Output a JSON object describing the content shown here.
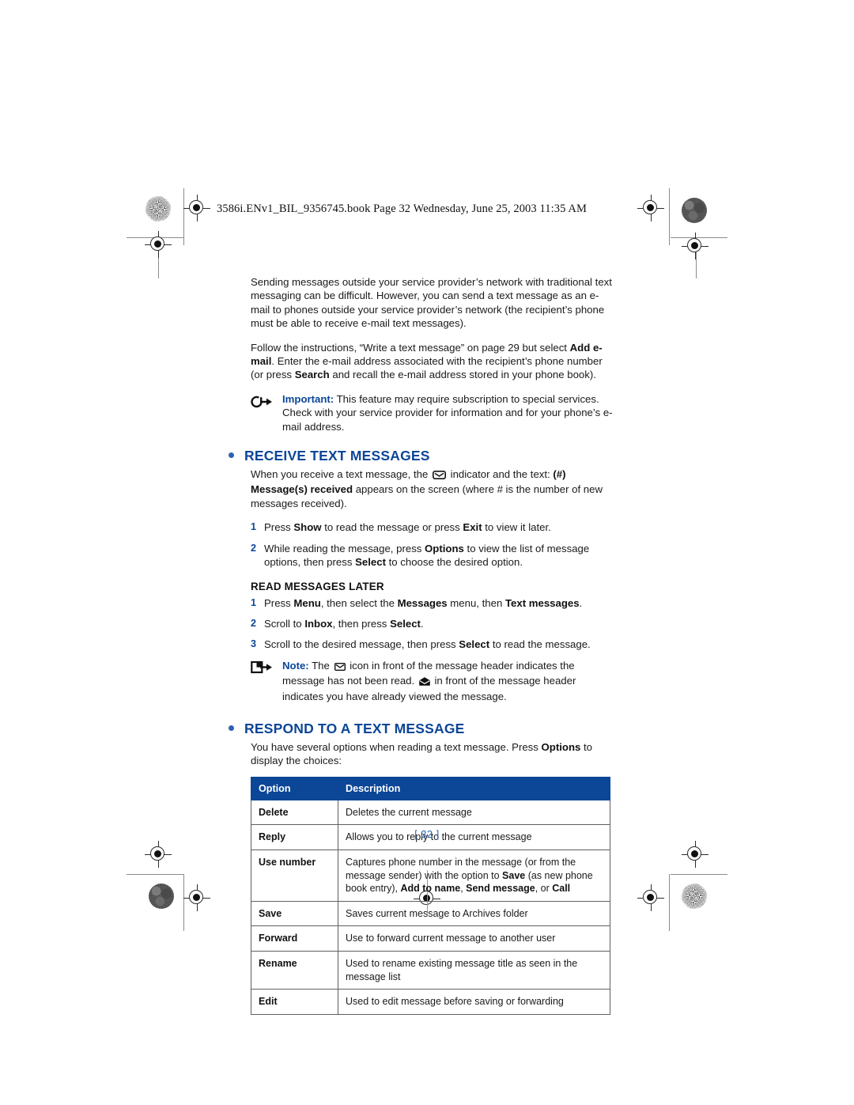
{
  "header": {
    "file_line": "3586i.ENv1_BIL_9356745.book  Page 32  Wednesday, June 25, 2003  11:35 AM"
  },
  "colors": {
    "heading_blue": "#0b4697",
    "bullet_blue": "#2b62b4",
    "table_header_bg": "#0b4697",
    "body_text": "#1a1a1a"
  },
  "intro": {
    "para1_a": "Sending messages outside your service provider’s network with traditional text messaging can be difficult. However, you can send a text message as an e-mail to phones outside your service provider’s network (the recipient’s phone must be able to receive e-mail text messages).",
    "para2_a": "Follow the instructions, “Write a text message” on page 29 but select ",
    "para2_b": "Add e-mail",
    "para2_c": ". Enter the e-mail address associated with the recipient’s phone number (or press ",
    "para2_d": "Search",
    "para2_e": " and recall the e-mail address stored in your phone book)."
  },
  "important_callout": {
    "icon": "circle-arrow-icon",
    "label": "Important:",
    "text": " This feature may require subscription to special services. Check with your service provider for information and for your phone’s e-mail address."
  },
  "receive_section": {
    "heading": "RECEIVE TEXT MESSAGES",
    "intro_a": "When you receive a text message, the ",
    "intro_icon": "envelope-indicator-icon",
    "intro_b": " indicator and the text: ",
    "intro_bold": "(#) Message(s) received",
    "intro_c": " appears on the screen (where # is the number of new messages received).",
    "steps": [
      {
        "num": "1",
        "a": "Press ",
        "b1": "Show",
        "c": " to read the message or press ",
        "b2": "Exit",
        "d": " to view it later."
      },
      {
        "num": "2",
        "a": "While reading the message, press ",
        "b1": "Options",
        "c": " to view the list of message options, then press ",
        "b2": "Select",
        "d": " to choose the desired option."
      }
    ]
  },
  "read_later": {
    "subheading": "READ MESSAGES LATER",
    "steps": [
      {
        "num": "1",
        "a": "Press ",
        "b1": "Menu",
        "c": ", then select the ",
        "b2": "Messages",
        "d": " menu, then ",
        "b3": "Text messages",
        "e": "."
      },
      {
        "num": "2",
        "a": "Scroll to ",
        "b1": "Inbox",
        "c": ", then press ",
        "b2": "Select",
        "d": "."
      },
      {
        "num": "3",
        "a": "Scroll to the desired message, then press ",
        "b1": "Select",
        "c": " to read the message."
      }
    ]
  },
  "note_callout": {
    "icon": "square-arrow-icon",
    "label": "Note:",
    "text_a": " The ",
    "icon_unread": "closed-envelope-icon",
    "text_b": " icon in front of the message header indicates the message has not been read. ",
    "icon_read": "opened-envelope-icon",
    "text_c": " in front of the message header indicates you have already viewed the message."
  },
  "respond_section": {
    "heading": "RESPOND TO A TEXT MESSAGE",
    "intro_a": "You have several options when reading a text message. Press ",
    "intro_bold": "Options",
    "intro_b": " to display the choices:"
  },
  "option_table": {
    "columns": [
      "Option",
      "Description"
    ],
    "rows": [
      {
        "option": "Delete",
        "desc_a": "Deletes the current message",
        "desc_bold1": "",
        "desc_b": "",
        "desc_bold2": "",
        "desc_c": "",
        "desc_bold3": "",
        "desc_d": ""
      },
      {
        "option": "Reply",
        "desc_a": "Allows you to reply to the current message",
        "desc_bold1": "",
        "desc_b": "",
        "desc_bold2": "",
        "desc_c": "",
        "desc_bold3": "",
        "desc_d": ""
      },
      {
        "option": "Use number",
        "desc_a": "Captures phone number in the message (or from the message sender) with the option to ",
        "desc_bold1": "Save",
        "desc_b": " (as new phone book entry), ",
        "desc_bold2": "Add to name",
        "desc_c": ", ",
        "desc_bold3": "Send message",
        "desc_d": ", or ",
        "desc_bold4": "Call"
      },
      {
        "option": "Save",
        "desc_a": "Saves current message to Archives folder",
        "desc_bold1": "",
        "desc_b": "",
        "desc_bold2": "",
        "desc_c": "",
        "desc_bold3": "",
        "desc_d": ""
      },
      {
        "option": "Forward",
        "desc_a": "Use to forward current message to another user",
        "desc_bold1": "",
        "desc_b": "",
        "desc_bold2": "",
        "desc_c": "",
        "desc_bold3": "",
        "desc_d": ""
      },
      {
        "option": "Rename",
        "desc_a": "Used to rename existing message title as seen in the message list",
        "desc_bold1": "",
        "desc_b": "",
        "desc_bold2": "",
        "desc_c": "",
        "desc_bold3": "",
        "desc_d": ""
      },
      {
        "option": "Edit",
        "desc_a": "Used to edit message before saving or forwarding",
        "desc_bold1": "",
        "desc_b": "",
        "desc_bold2": "",
        "desc_c": "",
        "desc_bold3": "",
        "desc_d": ""
      }
    ]
  },
  "footer": {
    "page_number": "[ 32 ]"
  }
}
